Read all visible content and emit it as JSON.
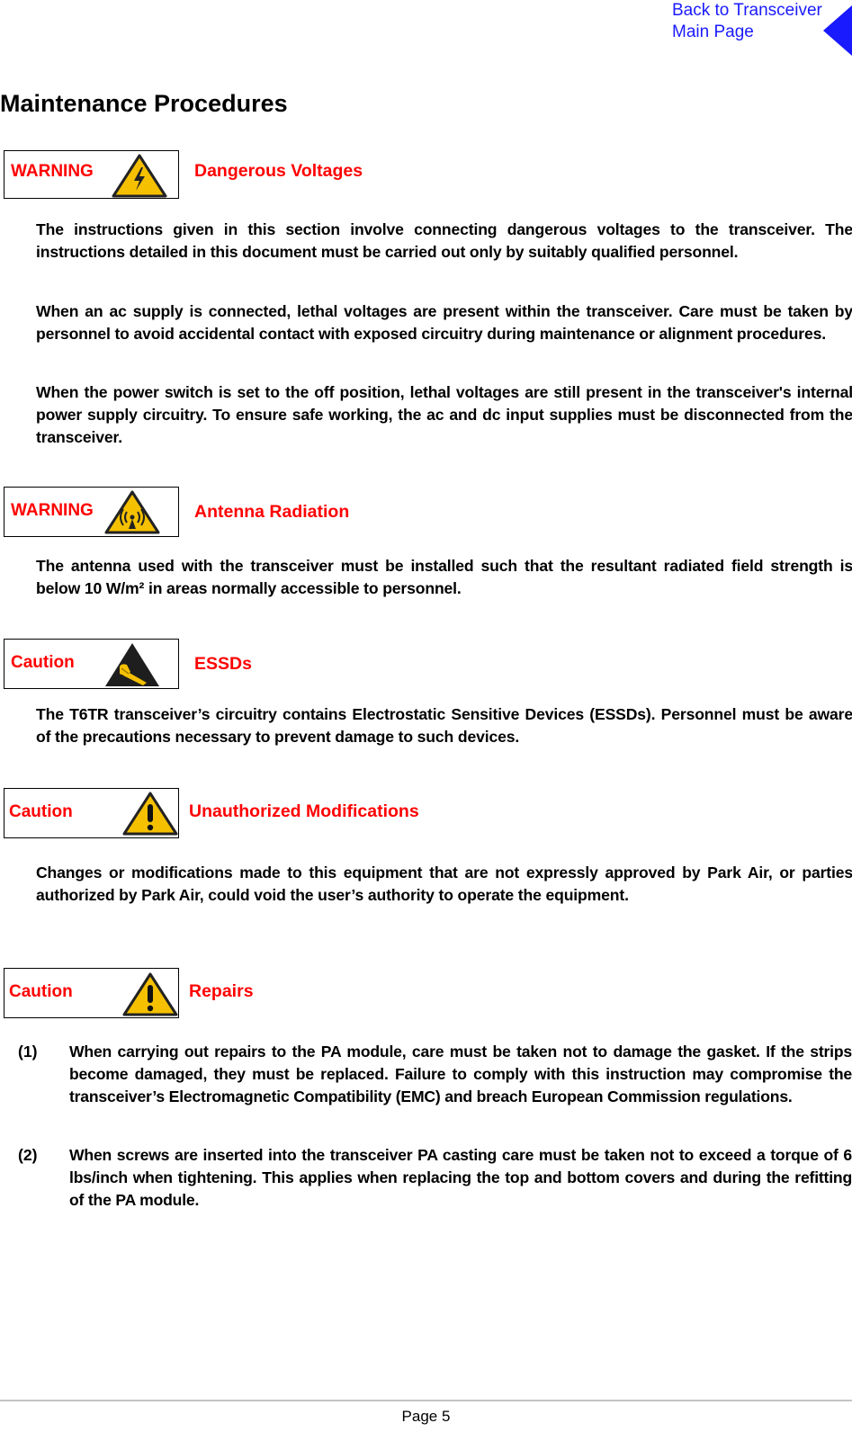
{
  "nav": {
    "back_link_line1": "Back to Transceiver",
    "back_link_line2": "Main Page",
    "link_color": "#1a1aff"
  },
  "page": {
    "title": "Maintenance Procedures",
    "page_number": "Page 5"
  },
  "notices": [
    {
      "label": "WARNING",
      "icon": "high-voltage-icon",
      "title": "Dangerous Voltages",
      "paragraphs": [
        "The instructions given in this section involve connecting dangerous voltages to the transceiver. The instructions detailed in this document must be carried out only by suitably qualified personnel.",
        "When an ac supply is connected, lethal voltages are present within the transceiver. Care must be taken by personnel to avoid accidental contact with exposed circuitry during maintenance or alignment procedures.",
        "When the power switch is set to the off position, lethal voltages are still present in the transceiver's internal power supply circuitry. To ensure safe working, the ac and dc input supplies must be disconnected from the transceiver."
      ]
    },
    {
      "label": "WARNING",
      "icon": "radiation-icon",
      "title": "Antenna Radiation",
      "paragraphs": [
        "The antenna used with the transceiver must be installed such that the resultant radiated field strength is below 10 W/m² in areas normally accessible to personnel."
      ]
    },
    {
      "label": "Caution",
      "icon": "esd-icon",
      "title": "ESSDs",
      "paragraphs": [
        "The T6TR transceiver’s circuitry contains Electrostatic Sensitive Devices (ESSDs). Personnel must be aware of the precautions necessary to prevent damage to such devices."
      ]
    },
    {
      "label": "Caution",
      "icon": "exclamation-warning-icon",
      "title": "Unauthorized Modifications",
      "paragraphs": [
        "Changes or modifications made to this equipment that are not expressly approved by Park Air, or parties authorized by Park Air, could void the user’s authority to operate the equipment."
      ]
    },
    {
      "label": "Caution",
      "icon": "exclamation-warning-icon",
      "title": "Repairs",
      "items": [
        {
          "number": "(1)",
          "text": "When carrying out repairs to the PA module, care must be taken not to damage the gasket. If the strips become damaged, they must be replaced. Failure to comply with this instruction may compromise the transceiver’s Electromagnetic Compatibility (EMC) and breach European Commission regulations."
        },
        {
          "number": "(2)",
          "text": "When screws are inserted into the transceiver PA casting care must be taken not to exceed a torque of 6 lbs/inch when tightening. This applies when replacing the top and bottom covers and during the refitting of the PA module."
        }
      ]
    }
  ],
  "colors": {
    "alert_red": "#ff0000",
    "hazard_yellow": "#f5c000",
    "footer_rule": "#c4c4c4"
  }
}
